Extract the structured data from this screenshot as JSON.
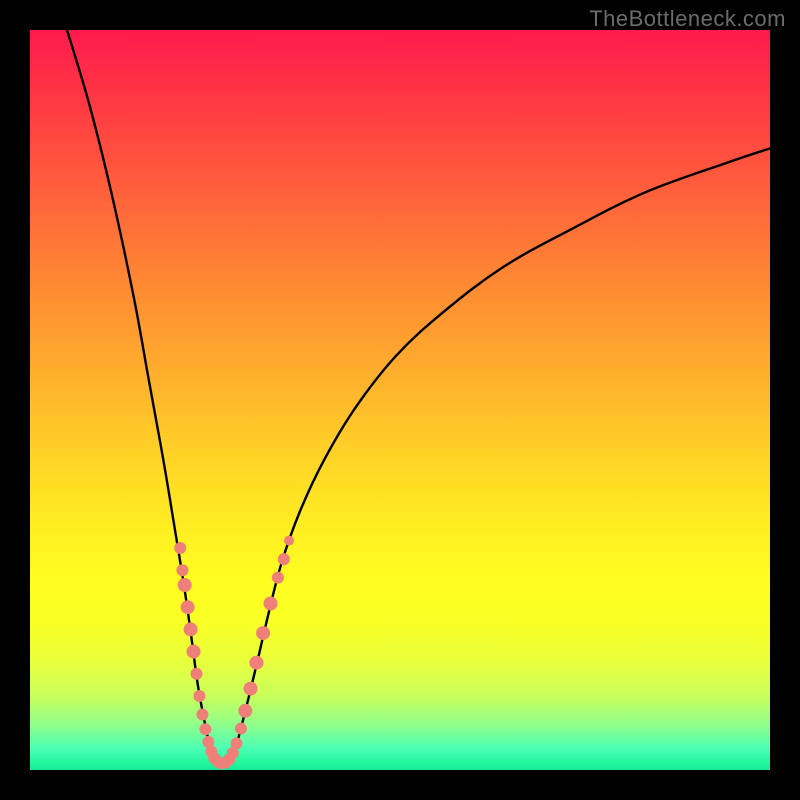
{
  "watermark": "TheBottleneck.com",
  "chart_data": {
    "type": "line",
    "title": "",
    "xlabel": "",
    "ylabel": "",
    "xlim": [
      0,
      100
    ],
    "ylim": [
      0,
      100
    ],
    "series": [
      {
        "name": "left-curve",
        "x": [
          5,
          8,
          11,
          14,
          16,
          18,
          19.5,
          20.8,
          21.8,
          22.6,
          23.3,
          23.9,
          24.4,
          24.8
        ],
        "values": [
          100,
          90,
          78,
          64,
          53,
          42,
          33,
          25,
          18,
          12,
          8,
          5,
          2.5,
          1
        ]
      },
      {
        "name": "right-curve",
        "x": [
          27.2,
          27.8,
          28.6,
          29.6,
          30.8,
          32.2,
          34,
          36.5,
          39.8,
          44,
          49.5,
          56,
          64,
          73,
          83,
          94,
          100
        ],
        "values": [
          1,
          3,
          6,
          10,
          15,
          21,
          28,
          35,
          42,
          49,
          56,
          62,
          68,
          73,
          78,
          82,
          84
        ]
      },
      {
        "name": "valley-floor",
        "x": [
          24.8,
          25.3,
          25.8,
          26.3,
          26.8,
          27.2
        ],
        "values": [
          1,
          0.6,
          0.5,
          0.5,
          0.7,
          1
        ]
      }
    ],
    "markers": [
      {
        "cluster": "left-branch",
        "x": 20.3,
        "y": 30,
        "r": 6
      },
      {
        "cluster": "left-branch",
        "x": 20.6,
        "y": 27,
        "r": 6
      },
      {
        "cluster": "left-branch",
        "x": 20.9,
        "y": 25,
        "r": 7
      },
      {
        "cluster": "left-branch",
        "x": 21.3,
        "y": 22,
        "r": 7
      },
      {
        "cluster": "left-branch",
        "x": 21.7,
        "y": 19,
        "r": 7
      },
      {
        "cluster": "left-branch",
        "x": 22.1,
        "y": 16,
        "r": 7
      },
      {
        "cluster": "left-branch",
        "x": 22.5,
        "y": 13,
        "r": 6
      },
      {
        "cluster": "left-branch",
        "x": 22.9,
        "y": 10,
        "r": 6
      },
      {
        "cluster": "left-branch",
        "x": 23.3,
        "y": 7.5,
        "r": 6
      },
      {
        "cluster": "left-branch",
        "x": 23.7,
        "y": 5.5,
        "r": 6
      },
      {
        "cluster": "left-branch",
        "x": 24.1,
        "y": 3.8,
        "r": 6
      },
      {
        "cluster": "left-branch",
        "x": 24.5,
        "y": 2.5,
        "r": 6
      },
      {
        "cluster": "valley",
        "x": 24.9,
        "y": 1.6,
        "r": 6
      },
      {
        "cluster": "valley",
        "x": 25.4,
        "y": 1.1,
        "r": 6
      },
      {
        "cluster": "valley",
        "x": 25.9,
        "y": 0.9,
        "r": 6
      },
      {
        "cluster": "valley",
        "x": 26.4,
        "y": 1.0,
        "r": 6
      },
      {
        "cluster": "valley",
        "x": 26.9,
        "y": 1.4,
        "r": 6
      },
      {
        "cluster": "right-branch",
        "x": 27.4,
        "y": 2.3,
        "r": 6
      },
      {
        "cluster": "right-branch",
        "x": 27.9,
        "y": 3.6,
        "r": 6
      },
      {
        "cluster": "right-branch",
        "x": 28.5,
        "y": 5.6,
        "r": 6
      },
      {
        "cluster": "right-branch",
        "x": 29.1,
        "y": 8,
        "r": 7
      },
      {
        "cluster": "right-branch",
        "x": 29.8,
        "y": 11,
        "r": 7
      },
      {
        "cluster": "right-branch",
        "x": 30.6,
        "y": 14.5,
        "r": 7
      },
      {
        "cluster": "right-branch",
        "x": 31.5,
        "y": 18.5,
        "r": 7
      },
      {
        "cluster": "right-branch",
        "x": 32.5,
        "y": 22.5,
        "r": 7
      },
      {
        "cluster": "right-branch",
        "x": 33.5,
        "y": 26,
        "r": 6
      },
      {
        "cluster": "right-branch",
        "x": 34.3,
        "y": 28.5,
        "r": 6
      },
      {
        "cluster": "right-branch",
        "x": 35.0,
        "y": 31,
        "r": 5
      }
    ],
    "colors": {
      "curve": "#000000",
      "marker_fill": "#ef8079",
      "marker_stroke": "#ef8079",
      "gradient_top": "#ff1a4d",
      "gradient_mid": "#fff022",
      "gradient_bottom": "#18e998",
      "frame": "#000000"
    }
  }
}
